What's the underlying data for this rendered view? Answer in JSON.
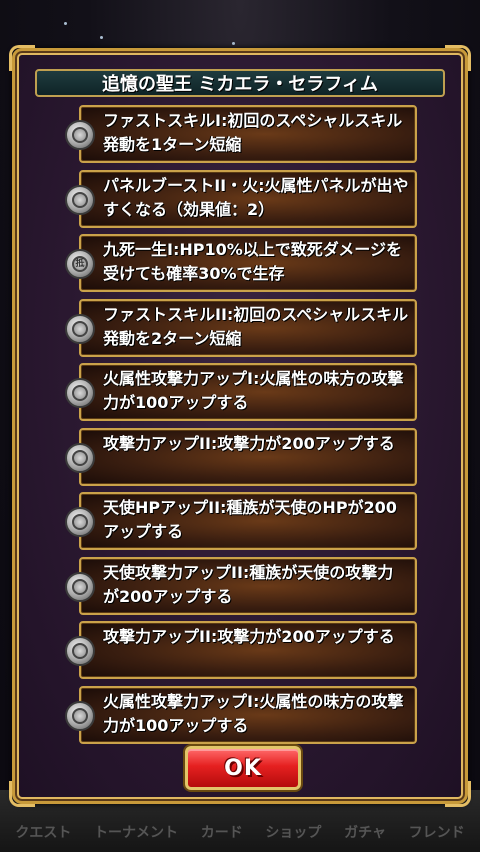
{
  "dialog": {
    "title": "追憶の聖王 ミカエラ・セラフィム",
    "ok_label": "OK"
  },
  "skills": [
    {
      "text": "ファストスキルI:初回のスペシャルスキル発動を1ターン短縮",
      "icon": "skill-fast-icon"
    },
    {
      "text": "パネルブーストII・火:火属性パネルが出やすくなる（効果値：2）",
      "icon": "panel-boost-icon"
    },
    {
      "text": "九死一生I:HP10%以上で致死ダメージを受けても確率30%で生存",
      "icon": "survive-icon",
      "glyph": "抵"
    },
    {
      "text": "ファストスキルII:初回のスペシャルスキル発動を2ターン短縮",
      "icon": "skill-fast-icon"
    },
    {
      "text": "火属性攻撃力アップI:火属性の味方の攻撃力が100アップする",
      "icon": "attack-up-icon"
    },
    {
      "text": "攻撃力アップII:攻撃力が200アップする",
      "icon": "attack-up-icon"
    },
    {
      "text": "天使HPアップII:種族が天使のHPが200アップする",
      "icon": "hp-up-icon"
    },
    {
      "text": "天使攻撃力アップII:種族が天使の攻撃力が200アップする",
      "icon": "attack-up-icon"
    },
    {
      "text": "攻撃力アップII:攻撃力が200アップする",
      "icon": "attack-up-icon"
    },
    {
      "text": "火属性攻撃力アップI:火属性の味方の攻撃力が100アップする",
      "icon": "attack-up-icon"
    }
  ],
  "background_tabs": [
    "クエスト",
    "トーナメント",
    "カード",
    "ショップ",
    "ガチャ",
    "フレンド"
  ],
  "colors": {
    "frame_gold": "#c89a3a",
    "title_bg": "#1f3b3f",
    "ok_red": "#e52020"
  }
}
